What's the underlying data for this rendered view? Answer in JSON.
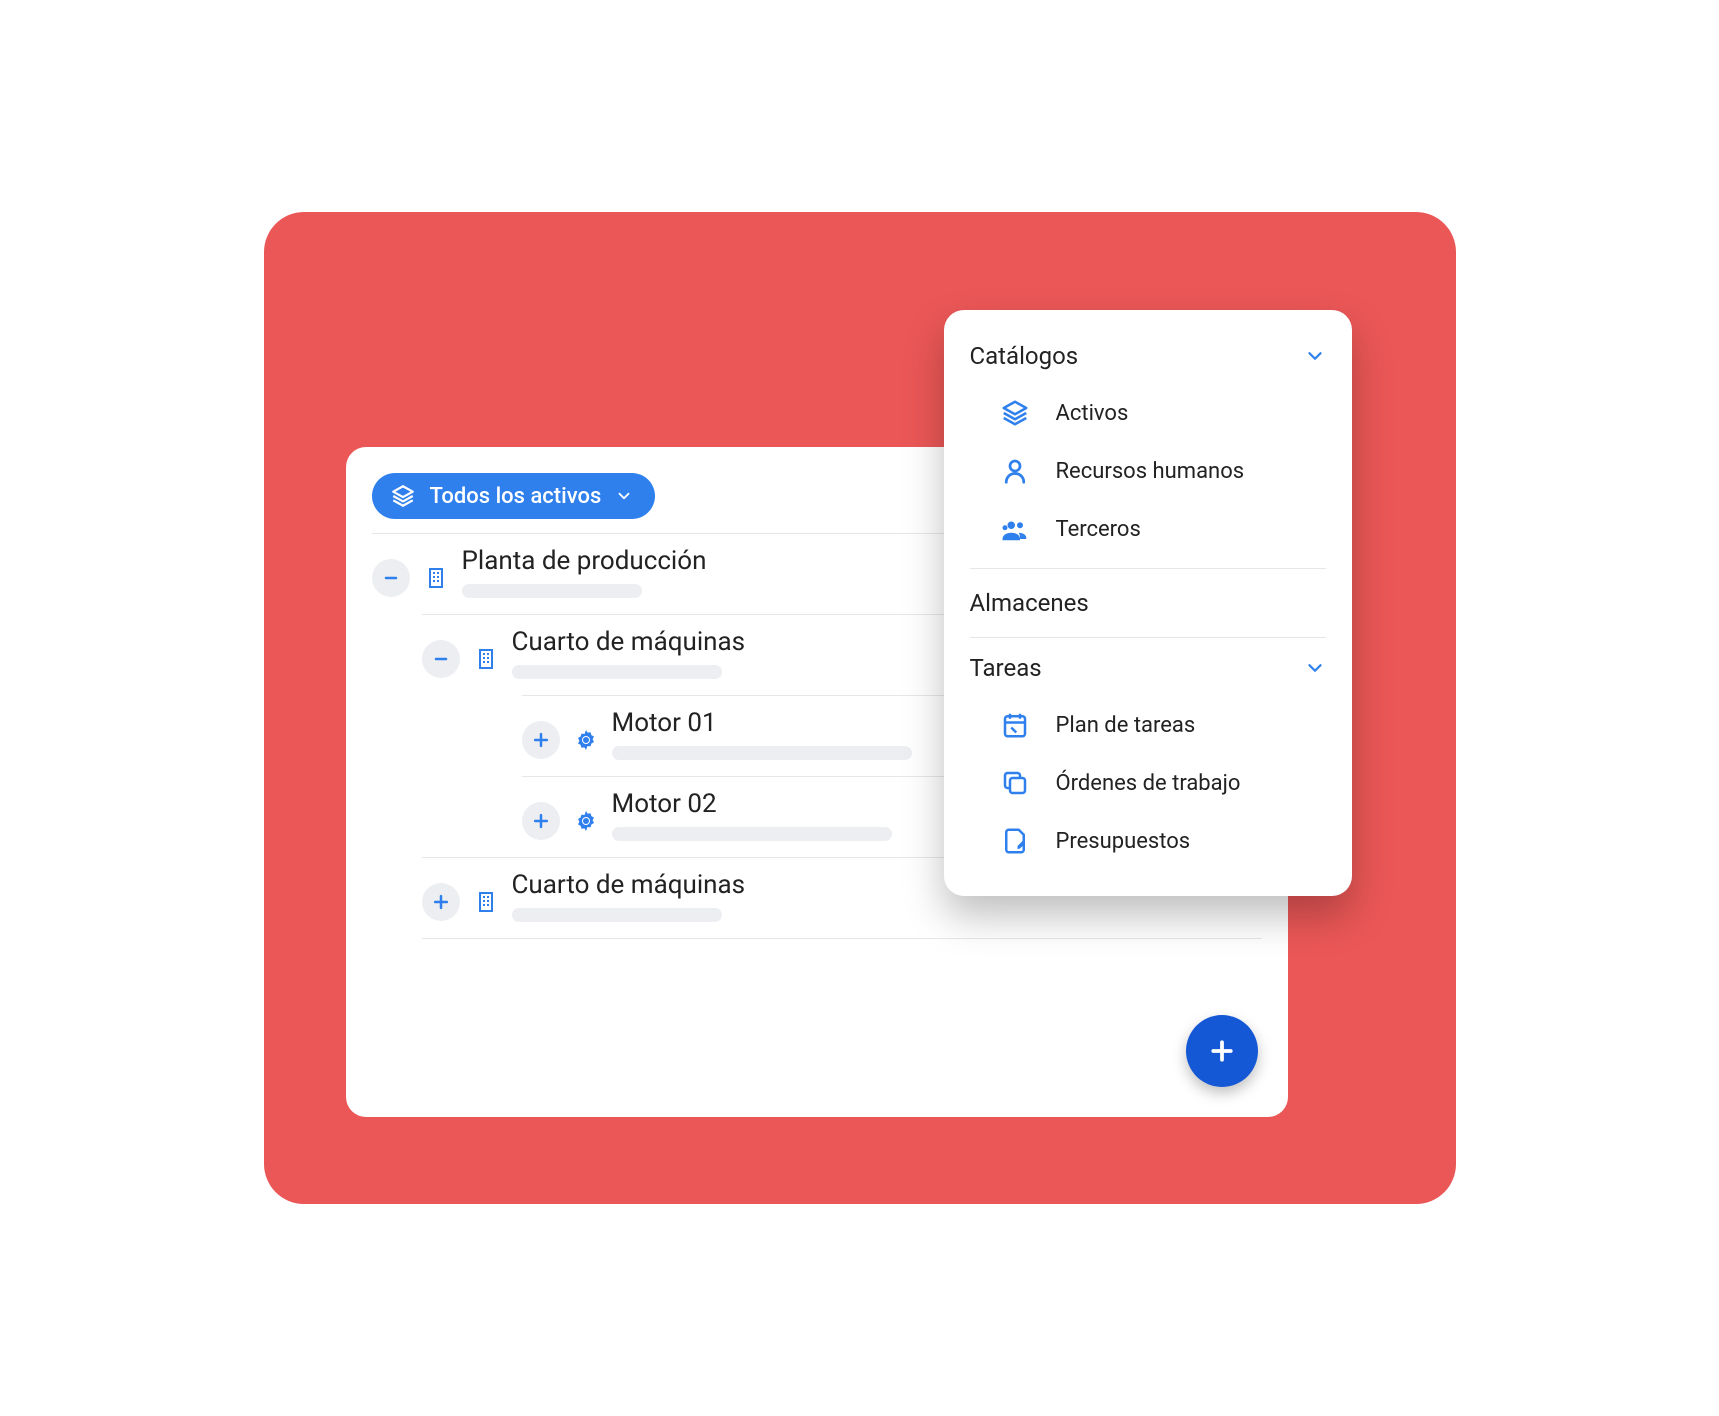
{
  "filter": {
    "label": "Todos los activos"
  },
  "tree": {
    "n0": {
      "label": "Planta de producción"
    },
    "n1": {
      "label": "Cuarto de máquinas"
    },
    "n2": {
      "label": "Motor 01"
    },
    "n3": {
      "label": "Motor 02"
    },
    "n4": {
      "label": "Cuarto de máquinas"
    }
  },
  "panel": {
    "catalogos": {
      "title": "Catálogos",
      "items": {
        "activos": "Activos",
        "recursos": "Recursos humanos",
        "terceros": "Terceros"
      }
    },
    "almacenes": {
      "title": "Almacenes"
    },
    "tareas": {
      "title": "Tareas",
      "items": {
        "plan": "Plan de tareas",
        "ordenes": "Órdenes de trabajo",
        "presupuestos": "Presupuestos"
      }
    }
  }
}
